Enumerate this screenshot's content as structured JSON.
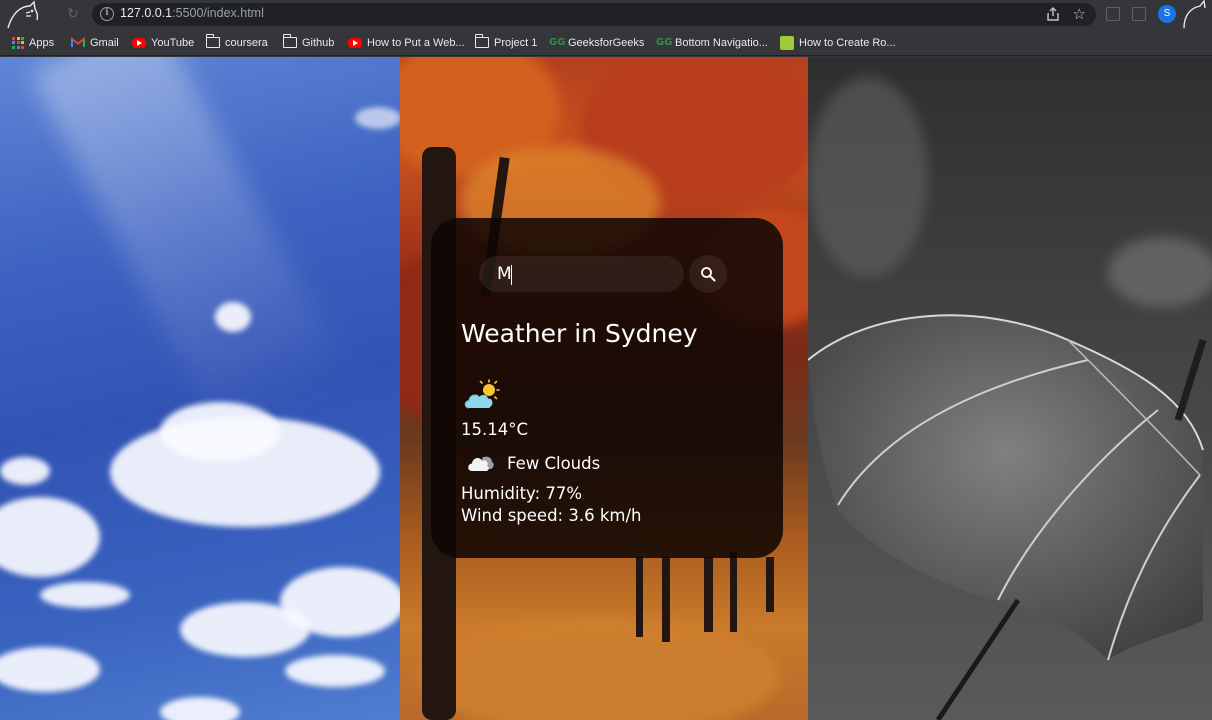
{
  "browser": {
    "url_host": "127.0.0.1",
    "url_rest": ":5500/index.html",
    "profile_initial": "S",
    "bookmarks": [
      {
        "label": "Apps",
        "icon": "apps-grid-icon"
      },
      {
        "label": "Gmail",
        "icon": "gmail-icon"
      },
      {
        "label": "YouTube",
        "icon": "youtube-icon"
      },
      {
        "label": "coursera",
        "icon": "folder-icon"
      },
      {
        "label": "Github",
        "icon": "folder-icon"
      },
      {
        "label": "How to Put a Web...",
        "icon": "youtube-icon"
      },
      {
        "label": "Project 1",
        "icon": "folder-icon"
      },
      {
        "label": "GeeksforGeeks",
        "icon": "geeksforgeeks-icon"
      },
      {
        "label": "Bottom Navigatio...",
        "icon": "geeksforgeeks-icon"
      },
      {
        "label": "How to Create Ro...",
        "icon": "site-icon"
      }
    ]
  },
  "weather": {
    "search_value": "M",
    "city_title": "Weather in Sydney",
    "main_icon": "partly-sunny-cloud-icon",
    "temperature": "15.14°C",
    "description_icon": "cloud-icon",
    "description": "Few Clouds",
    "humidity": "Humidity: 77%",
    "wind": "Wind speed: 3.6 km/h"
  },
  "colors": {
    "card_background": "#0e0604",
    "text": "#ffffff",
    "sky": "#3253b4",
    "autumn": "#c9541f",
    "rain": "#3d3d3d"
  }
}
